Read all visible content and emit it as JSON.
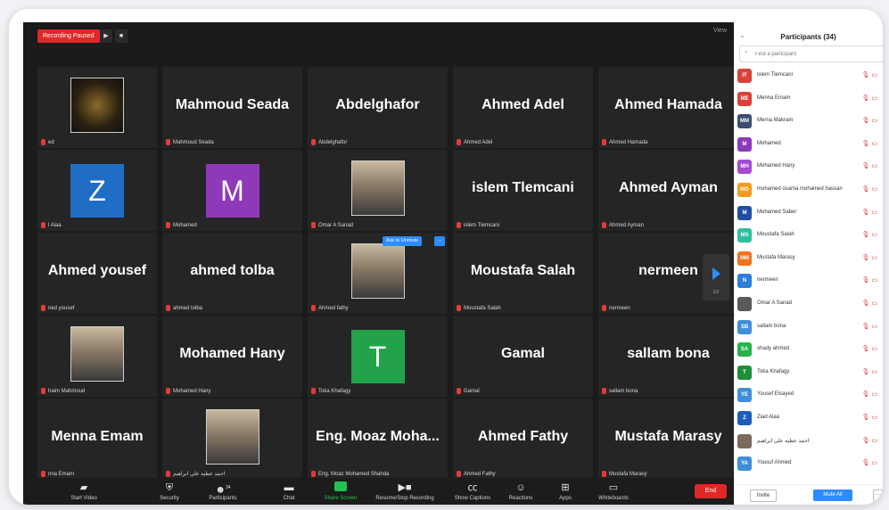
{
  "topbar": {
    "recording_label": "Recording Paused",
    "pause_glyph": "▶",
    "stop_glyph": "■",
    "view_label": "View"
  },
  "tiles": [
    {
      "type": "logo",
      "big": "",
      "footer": "ed"
    },
    {
      "type": "name",
      "big": "Mahmoud Seada",
      "footer": "Mahmoud Seada"
    },
    {
      "type": "name",
      "big": "Abdelghafor",
      "footer": "Abdelghafor"
    },
    {
      "type": "name",
      "big": "Ahmed Adel",
      "footer": "Ahmed Adel"
    },
    {
      "type": "name",
      "big": "Ahmed Hamada",
      "footer": "Ahmed Hamada"
    },
    {
      "type": "letter",
      "letter": "Z",
      "color": "#1f6ec4",
      "footer": "l Alaa"
    },
    {
      "type": "letter",
      "letter": "M",
      "color": "#8e3ab8",
      "footer": "Mohamed"
    },
    {
      "type": "photo",
      "footer": "Omar A Sanad"
    },
    {
      "type": "name",
      "big": "islem Tlemcani",
      "footer": "islem Tlemcani"
    },
    {
      "type": "name",
      "big": "Ahmed Ayman",
      "footer": "Ahmed Ayman"
    },
    {
      "type": "name",
      "big": "Ahmed yousef",
      "footer": "ned yousef"
    },
    {
      "type": "name",
      "big": "ahmed tolba",
      "footer": "ahmed tolba"
    },
    {
      "type": "photo",
      "footer": "Ahmed fathy",
      "ask": "Ask to Unmute",
      "ask_more": "···"
    },
    {
      "type": "name",
      "big": "Moustafa Salah",
      "footer": "Moustafa Salah"
    },
    {
      "type": "name",
      "big": "nermeen",
      "footer": "nermeen"
    },
    {
      "type": "photo",
      "footer": "haim Mahmoud"
    },
    {
      "type": "name",
      "big": "Mohamed Hany",
      "footer": "Mohamed Hany"
    },
    {
      "type": "letter",
      "letter": "T",
      "color": "#22a34a",
      "footer": "Toka Khafagy"
    },
    {
      "type": "name",
      "big": "Gamal",
      "footer": "Gamal"
    },
    {
      "type": "name",
      "big": "sallam bona",
      "footer": "sallam bona"
    },
    {
      "type": "name",
      "big": "Menna Emam",
      "footer": "nna Emam"
    },
    {
      "type": "photo",
      "footer": "احمد عطيه علي ابراهيم"
    },
    {
      "type": "name",
      "big": "Eng. Moaz Moha...",
      "footer": "Eng. Moaz Mohamed Shahda"
    },
    {
      "type": "name",
      "big": "Ahmed Fathy",
      "footer": "Ahmed Fathy"
    },
    {
      "type": "name",
      "big": "Mustafa Marasy",
      "footer": "Mustafa Marasy"
    }
  ],
  "pager": {
    "label": "1/2"
  },
  "toolbar": {
    "start_video": "Start Video",
    "security": "Security",
    "participants": "Participants",
    "participants_count": "34",
    "chat": "Chat",
    "share_screen": "Share Screen",
    "resume_recording": "Resume/Stop Recording",
    "captions": "Show Captions",
    "reactions": "Reactions",
    "apps": "Apps",
    "whiteboards": "Whiteboards",
    "end": "End"
  },
  "panel": {
    "title": "Participants (34)",
    "search_placeholder": "Find a participant",
    "invite": "Invite",
    "mute_all": "Mute All",
    "more": "···",
    "participants": [
      {
        "initials": "IT",
        "color": "#d9423a",
        "name": "islem Tlemcani"
      },
      {
        "initials": "ME",
        "color": "#d9423a",
        "name": "Menna Emam"
      },
      {
        "initials": "MM",
        "color": "#3b4e6d",
        "name": "Merna Makram"
      },
      {
        "initials": "M",
        "color": "#8e3ab8",
        "name": "Mohamed"
      },
      {
        "initials": "MH",
        "color": "#a54ad3",
        "name": "Mohamed Hany"
      },
      {
        "initials": "MO",
        "color": "#f39c21",
        "name": "mohamed osama mohamed hassan"
      },
      {
        "initials": "M",
        "color": "#1f4fa3",
        "name": "Mohamed Saber"
      },
      {
        "initials": "MS",
        "color": "#2dbfa0",
        "name": "Moustafa Salah"
      },
      {
        "initials": "MM",
        "color": "#f0731f",
        "name": "Mustafa Marasy"
      },
      {
        "initials": "N",
        "color": "#2d7ed6",
        "name": "nermeen"
      },
      {
        "initials": "",
        "color": "#5a5a5a",
        "name": "Omar A Sanad"
      },
      {
        "initials": "SB",
        "color": "#3f8fd6",
        "name": "sallam bona"
      },
      {
        "initials": "SA",
        "color": "#27b24a",
        "name": "shady ahmed"
      },
      {
        "initials": "T",
        "color": "#1e8f3a",
        "name": "Toka Khafagy"
      },
      {
        "initials": "YE",
        "color": "#3f8fd6",
        "name": "Yousef Elsayed"
      },
      {
        "initials": "Z",
        "color": "#1f5cb8",
        "name": "Ziad Alaa"
      },
      {
        "initials": "",
        "color": "#7a6a5a",
        "name": "احمد عطيه علي ابراهيم"
      },
      {
        "initials": "YA",
        "color": "#3f8fd6",
        "name": "Yousuf Ahmed"
      }
    ]
  }
}
